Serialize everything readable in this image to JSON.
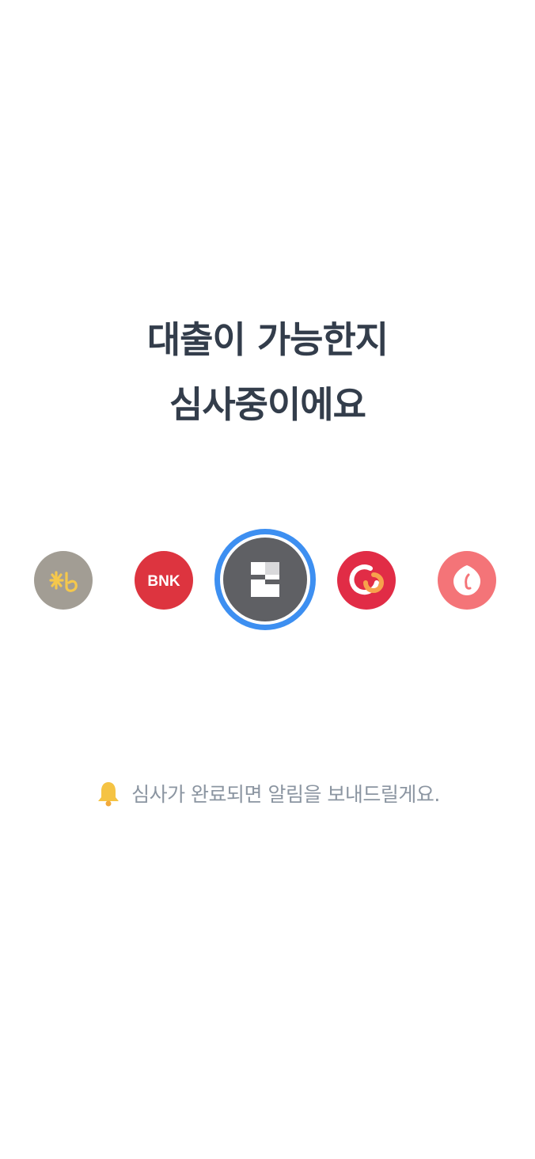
{
  "title": {
    "line1": "대출이 가능한지",
    "line2": "심사중이에요"
  },
  "banks": [
    {
      "name": "KB",
      "logo_text": "Kb",
      "color": "#a29d94",
      "icon": "kb-logo-icon"
    },
    {
      "name": "BNK",
      "logo_text": "BNK",
      "color": "#dd343f",
      "icon": "bnk-logo-icon"
    },
    {
      "name": "active",
      "color": "#5f6064",
      "ring_color": "#3d8ff1",
      "icon": "bank-logo-icon",
      "selected": true
    },
    {
      "name": "woori",
      "color": "#e12c46",
      "icon": "woori-logo-icon"
    },
    {
      "name": "lotte",
      "color": "#f47478",
      "icon": "lotte-logo-icon"
    }
  ],
  "notice": {
    "icon": "bell-icon",
    "text": "심사가 완료되면 알림을 보내드릴게요."
  },
  "colors": {
    "title": "#333d4b",
    "notice_text": "#8b95a1",
    "bell": "#f5c343",
    "accent": "#3d8ff1"
  }
}
